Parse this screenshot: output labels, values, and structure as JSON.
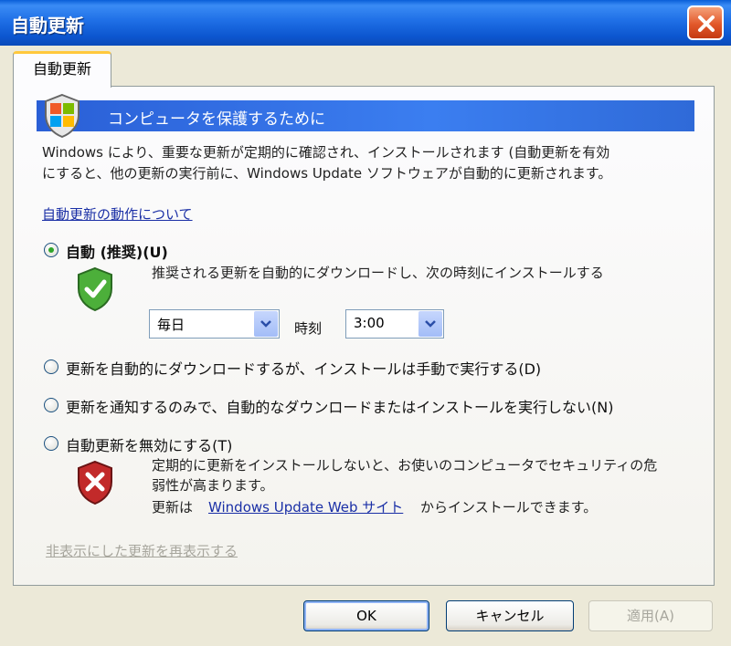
{
  "window": {
    "title": "自動更新",
    "tab_label": "自動更新"
  },
  "banner": {
    "text": "コンピュータを保護するために"
  },
  "description": {
    "line1": "Windows により、重要な更新が定期的に確認され、インストールされます (自動更新を有効",
    "line2": "にすると、他の更新の実行前に、Windows Update ソフトウェアが自動的に更新されます。"
  },
  "links": {
    "how_it_works": "自動更新の動作について",
    "windows_update_site": "Windows Update Web サイト",
    "restore_hidden": "非表示にした更新を再表示する"
  },
  "options": {
    "auto": {
      "label": "自動 (推奨)(U)",
      "desc": "推奨される更新を自動的にダウンロードし、次の時刻にインストールする",
      "selected": true
    },
    "download_only": {
      "label": "更新を自動的にダウンロードするが、インストールは手動で実行する(D)",
      "selected": false
    },
    "notify_only": {
      "label": "更新を通知するのみで、自動的なダウンロードまたはインストールを実行しない(N)",
      "selected": false
    },
    "off": {
      "label": "自動更新を無効にする(T)",
      "warn1": "定期的に更新をインストールしないと、お使いのコンピュータでセキュリティの危",
      "warn2": "弱性が高まります。",
      "warn3_prefix": "更新は",
      "warn3_suffix": "からインストールできます。",
      "selected": false
    }
  },
  "schedule": {
    "day_value": "毎日",
    "time_label": "時刻",
    "time_value": "3:00"
  },
  "buttons": {
    "ok": "OK",
    "cancel": "キャンセル",
    "apply": "適用(A)"
  },
  "icons": {
    "close": "close-icon",
    "shield_banner": "windows-security-shield-icon",
    "shield_ok": "green-check-shield-icon",
    "shield_warn": "red-x-shield-icon",
    "dropdown": "chevron-down-icon"
  },
  "colors": {
    "titlebar": "#1f6fe6",
    "banner": "#3b7ef0",
    "link": "#1a2fa6",
    "radio_dot": "#2fa52a",
    "close": "#e2582a"
  }
}
